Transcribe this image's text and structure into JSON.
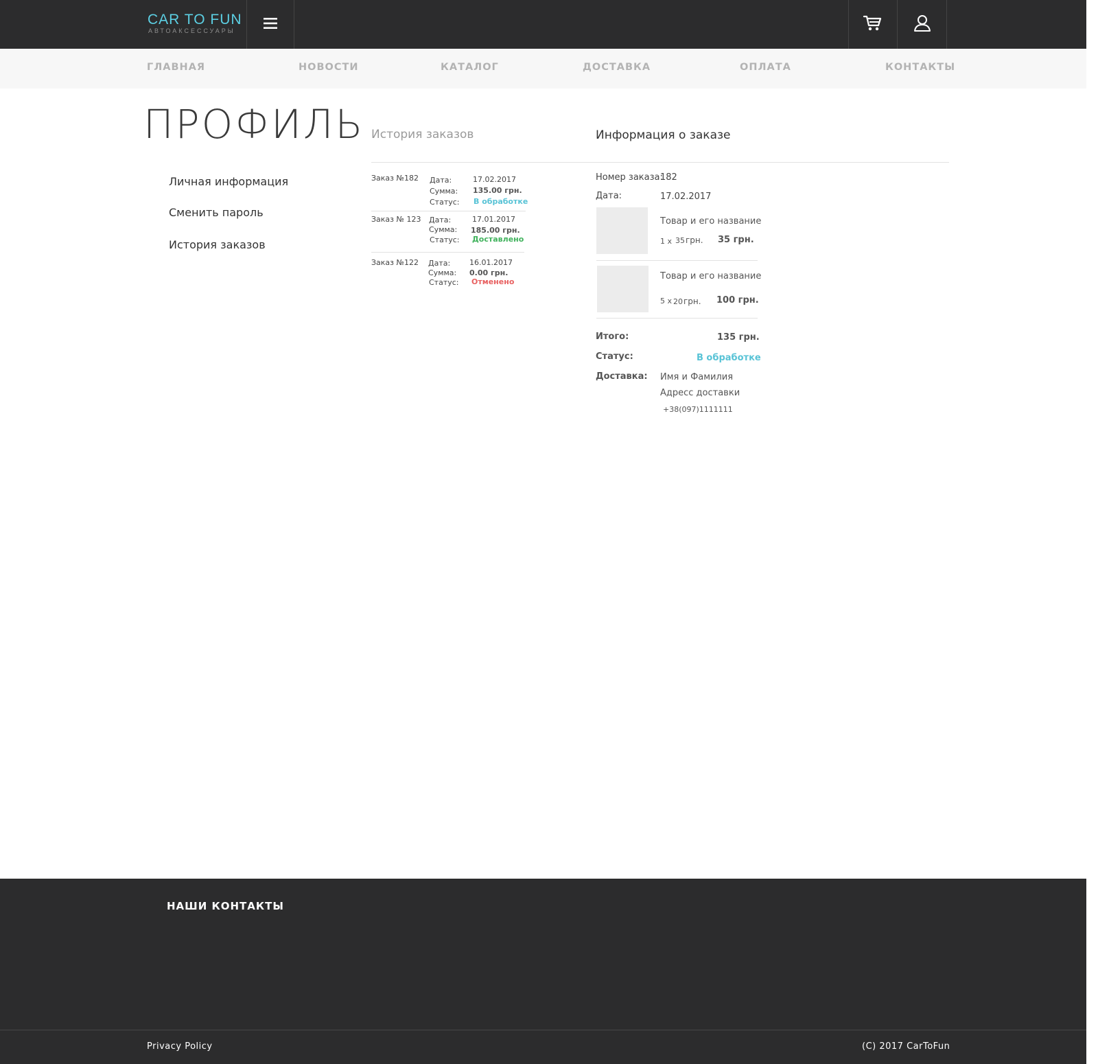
{
  "header": {
    "logo_title": "CAR TO FUN",
    "logo_subtitle": "АВТОАКСЕССУАРЫ",
    "accent_color": "#5ccfe3",
    "menu_icon": "hamburger-icon",
    "cart_icon": "cart-icon",
    "user_icon": "user-icon"
  },
  "nav": [
    "ГЛАВНАЯ",
    "НОВОСТИ",
    "КАТАЛОГ",
    "ДОСТАВКА",
    "ОПЛАТА",
    "КОНТАКТЫ"
  ],
  "profile": {
    "title": "ПРОФИЛЬ",
    "menu": [
      "Личная информация",
      "Сменить пароль",
      "История заказов"
    ]
  },
  "history": {
    "heading": "История заказов",
    "orders": [
      {
        "label": "Заказ №182",
        "date_label": "Дата:",
        "date": "17.02.2017",
        "sum_label": "Сумма:",
        "sum": "135.00 грн.",
        "status_label": "Статус:",
        "status": "В обработке"
      },
      {
        "label": "Заказ № 123",
        "date_label": "Дата:",
        "date": "17.01.2017",
        "sum_label": "Сумма:",
        "sum": "185.00 грн.",
        "status_label": "Статус:",
        "status": "Доставлено"
      },
      {
        "label": "Заказ №122",
        "date_label": "Дата:",
        "date": "16.01.2017",
        "sum_label": "Сумма:",
        "sum": "0.00 грн.",
        "status_label": "Статус:",
        "status": "Отменено"
      }
    ]
  },
  "order_info": {
    "heading": "Информация о заказе",
    "number_label": "Номер заказа:",
    "number": "182",
    "date_label": "Дата:",
    "date": "17.02.2017",
    "items": [
      {
        "name": "Товар и его название",
        "qty": "1 x",
        "unit_price": "35",
        "currency": "грн.",
        "total": "35 грн."
      },
      {
        "name": "Товар и его название",
        "qty": "5 x",
        "unit_price": "20",
        "currency": "грн.",
        "total": "100 грн."
      }
    ],
    "total_label": "Итого:",
    "total": "135 грн.",
    "status_label": "Статус:",
    "status": "В обработке",
    "delivery_label": "Доставка:",
    "delivery_name": "Имя и Фамилия",
    "delivery_address": "Адресс доставки",
    "delivery_phone": "+38(097)1111111"
  },
  "footer": {
    "contacts_title": "НАШИ КОНТАКТЫ",
    "privacy": "Privacy Policy",
    "copyright": "(C) 2017 CarToFun"
  }
}
